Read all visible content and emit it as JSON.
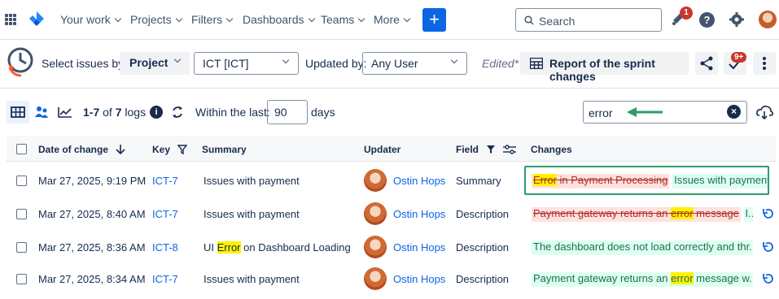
{
  "topnav": {
    "items": [
      {
        "label": "Your work"
      },
      {
        "label": "Projects"
      },
      {
        "label": "Filters"
      },
      {
        "label": "Dashboards"
      },
      {
        "label": "Teams"
      },
      {
        "label": "More"
      }
    ],
    "create_label": "+",
    "search_placeholder": "Search",
    "notification_count": "1",
    "help_label": "?"
  },
  "toolbar": {
    "select_issues_label": "Select issues by:",
    "project_type": "Project",
    "project_value": "ICT [ICT]",
    "updated_by_label": "Updated by:",
    "updated_by_value": "Any User",
    "edited_label": "Edited*",
    "report_label": "Report of the sprint changes",
    "badge_count": "9+"
  },
  "filterbar": {
    "logs_range": "1-7",
    "logs_of": "of",
    "logs_total": "7",
    "logs_word": "logs",
    "info_label": "i",
    "within_label": "Within the last:",
    "days_value": "90",
    "days_label": "days",
    "filter_value": "error"
  },
  "table": {
    "headers": {
      "date": "Date of change",
      "key": "Key",
      "summary": "Summary",
      "updater": "Updater",
      "field": "Field",
      "changes": "Changes"
    },
    "rows": [
      {
        "date": "Mar 27, 2025, 9:19 PM",
        "key": "ICT-7",
        "summary_pre": "Issues with payment",
        "summary_hl": "",
        "summary_post": "",
        "updater": "Ostin Hops",
        "field": "Summary",
        "old_hl": "Error",
        "old_text": " in Payment Processing",
        "new_pre": "Issues with payment",
        "new_hl": "",
        "new_post": ""
      },
      {
        "date": "Mar 27, 2025, 8:40 AM",
        "key": "ICT-7",
        "summary_pre": "Issues with payment",
        "summary_hl": "",
        "summary_post": "",
        "updater": "Ostin Hops",
        "field": "Description",
        "old_hl_pre": "Payment gateway returns an ",
        "old_hl": "error",
        "old_text": " message",
        "new_pre": "I...",
        "new_hl": "",
        "new_post": ""
      },
      {
        "date": "Mar 27, 2025, 8:36 AM",
        "key": "ICT-8",
        "summary_pre": "UI ",
        "summary_hl": "Error",
        "summary_post": " on Dashboard Loading",
        "updater": "Ostin Hops",
        "field": "Description",
        "new_pre": "The dashboard does not load correctly and thr...",
        "new_hl": "",
        "new_post": ""
      },
      {
        "date": "Mar 27, 2025, 8:34 AM",
        "key": "ICT-7",
        "summary_pre": "Issues with payment",
        "summary_hl": "",
        "summary_post": "",
        "updater": "Ostin Hops",
        "field": "Description",
        "new_pre": "Payment gateway returns an ",
        "new_hl": "error",
        "new_post": " message w..."
      }
    ]
  },
  "colors": {
    "accent": "#0c66e4",
    "annotation": "#2a9d6b",
    "highlight": "#fff200"
  }
}
